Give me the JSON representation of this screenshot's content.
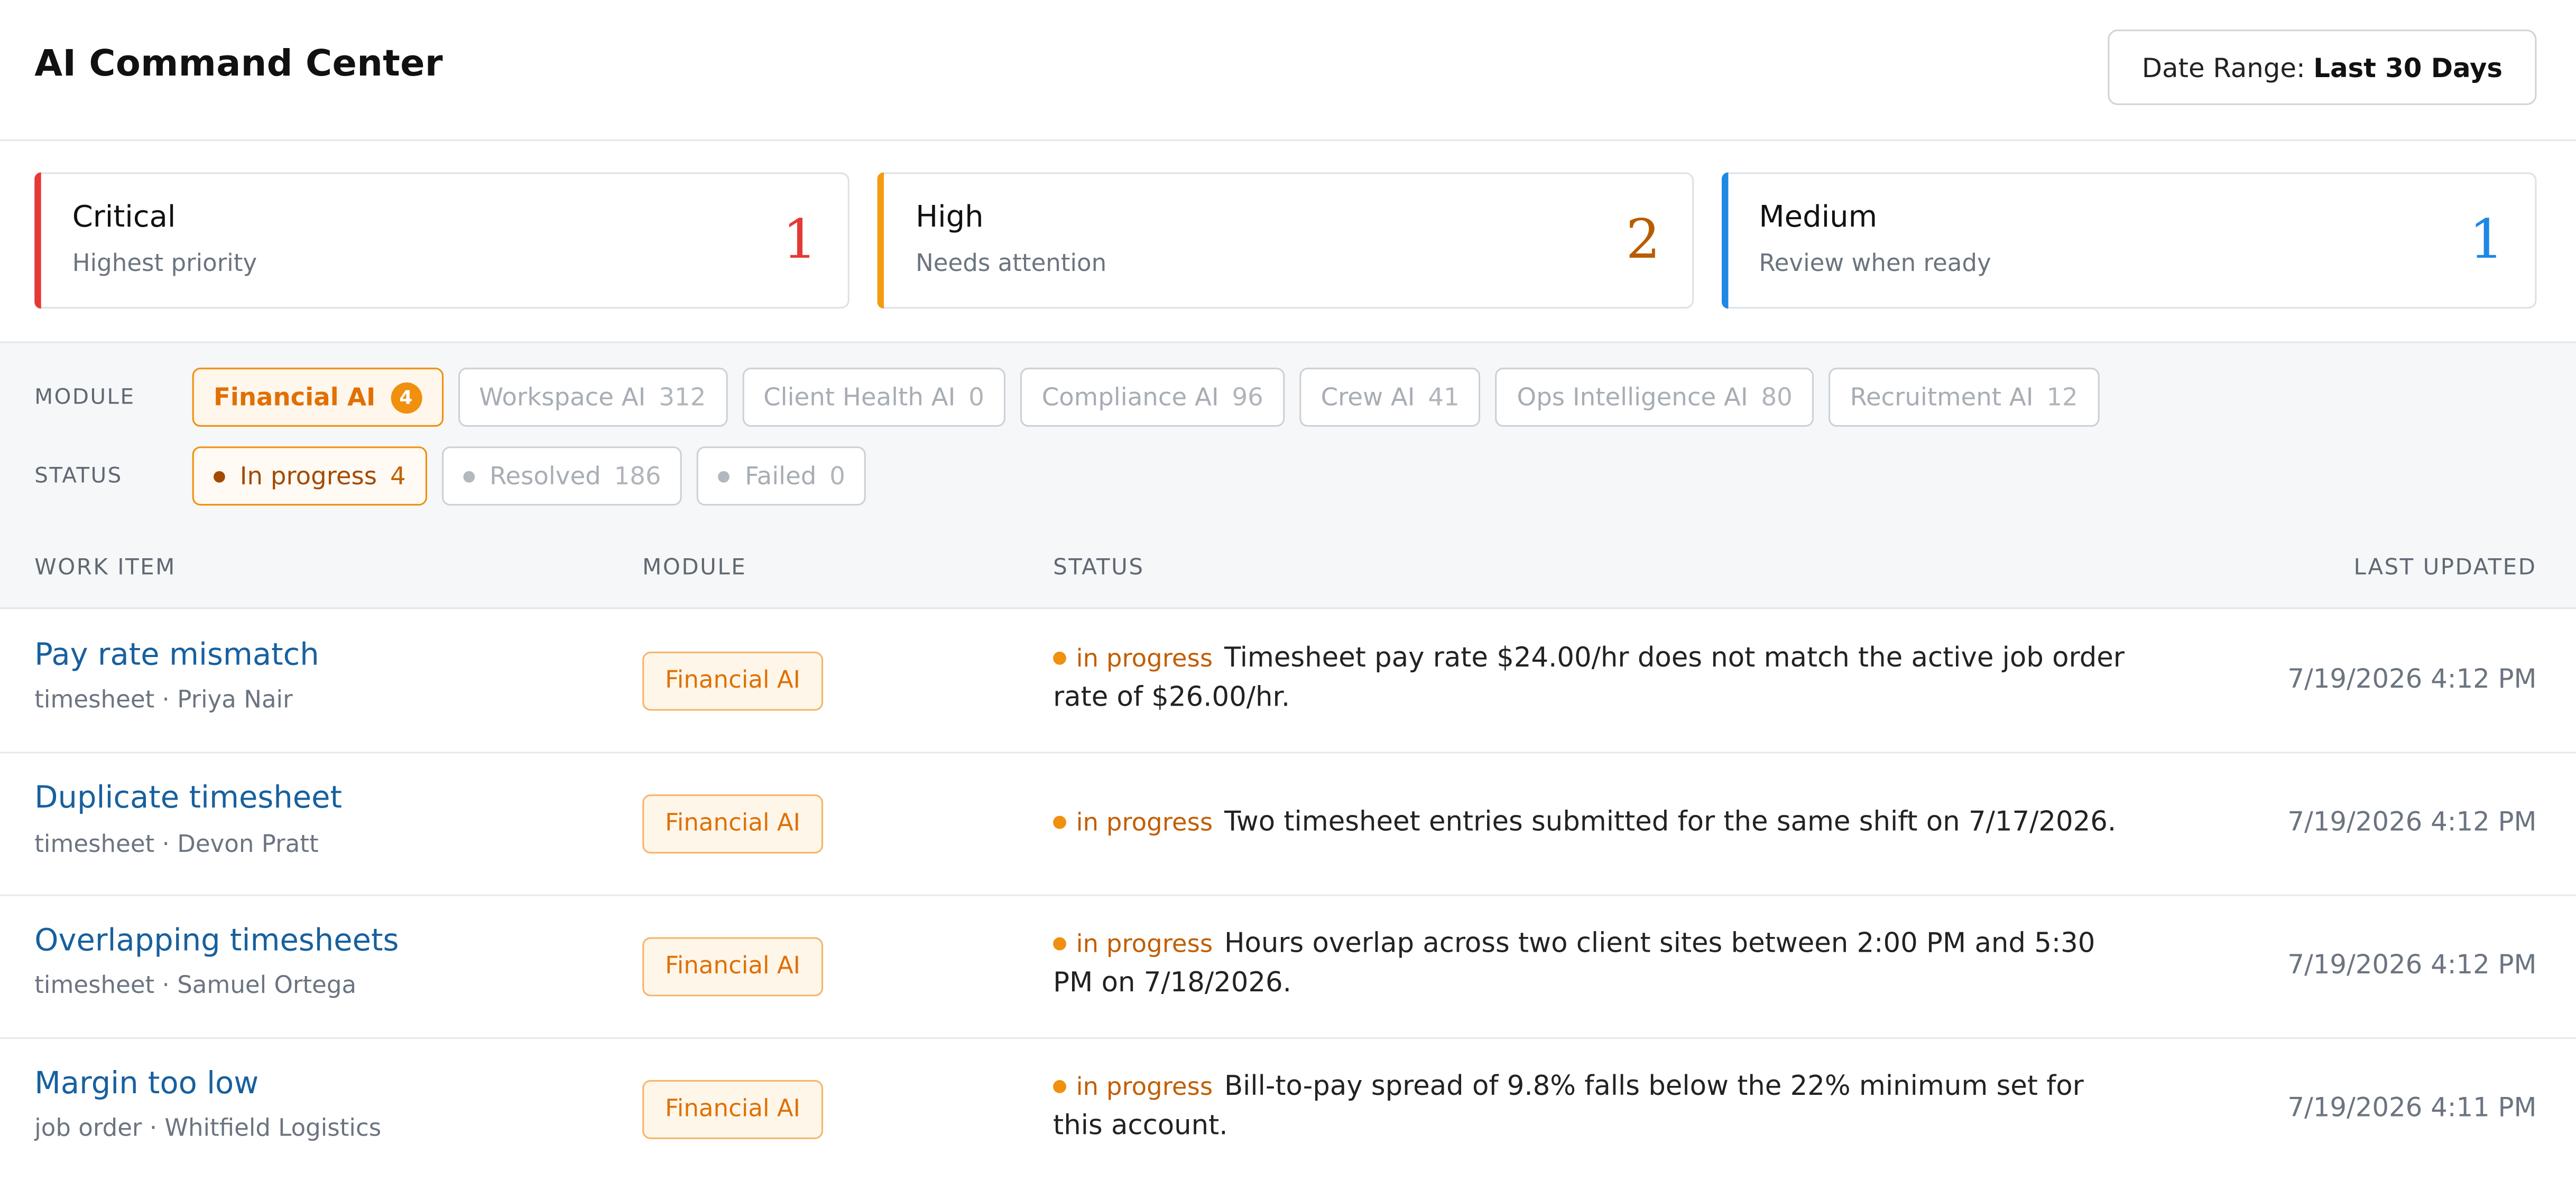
{
  "app": {
    "title": "AI Command Center"
  },
  "date_range": {
    "label": "Date Range:",
    "value": "Last 30 Days"
  },
  "priorities": [
    {
      "label": "Critical",
      "subtitle": "Highest priority",
      "count": "1",
      "color": "#e53935"
    },
    {
      "label": "High",
      "subtitle": "Needs attention",
      "count": "2",
      "color": "#f39c12"
    },
    {
      "label": "Medium",
      "subtitle": "Review when ready",
      "count": "1",
      "color": "#1e88e5"
    }
  ],
  "filters": {
    "module_label": "MODULE",
    "status_label": "STATUS",
    "modules": [
      {
        "name": "Financial AI",
        "count": "4",
        "active": true
      },
      {
        "name": "Workspace AI",
        "count": "312",
        "active": false
      },
      {
        "name": "Client Health AI",
        "count": "0",
        "active": false
      },
      {
        "name": "Compliance AI",
        "count": "96",
        "active": false
      },
      {
        "name": "Crew AI",
        "count": "41",
        "active": false
      },
      {
        "name": "Ops Intelligence AI",
        "count": "80",
        "active": false
      },
      {
        "name": "Recruitment AI",
        "count": "12",
        "active": false
      }
    ],
    "statuses": [
      {
        "name": "In progress",
        "count": "4",
        "active": true
      },
      {
        "name": "Resolved",
        "count": "186",
        "active": false
      },
      {
        "name": "Failed",
        "count": "0",
        "active": false
      }
    ]
  },
  "table": {
    "headers": {
      "work_item": "WORK ITEM",
      "module": "MODULE",
      "status": "STATUS",
      "last_updated": "LAST UPDATED"
    },
    "rows": [
      {
        "title": "Pay rate mismatch",
        "meta": "timesheet · Priya Nair",
        "module": "Financial AI",
        "status": "in progress",
        "message": "Timesheet pay rate $24.00/hr does not match the active job order rate of $26.00/hr.",
        "updated": "7/19/2026 4:12 PM"
      },
      {
        "title": "Duplicate timesheet",
        "meta": "timesheet · Devon Pratt",
        "module": "Financial AI",
        "status": "in progress",
        "message": "Two timesheet entries submitted for the same shift on 7/17/2026.",
        "updated": "7/19/2026 4:12 PM"
      },
      {
        "title": "Overlapping timesheets",
        "meta": "timesheet · Samuel Ortega",
        "module": "Financial AI",
        "status": "in progress",
        "message": "Hours overlap across two client sites between 2:00 PM and 5:30 PM on 7/18/2026.",
        "updated": "7/19/2026 4:12 PM"
      },
      {
        "title": "Margin too low",
        "meta": "job order · Whitfield Logistics",
        "module": "Financial AI",
        "status": "in progress",
        "message": "Bill-to-pay spread of 9.8% falls below the 22% minimum set for this account.",
        "updated": "7/19/2026 4:11 PM"
      }
    ]
  }
}
